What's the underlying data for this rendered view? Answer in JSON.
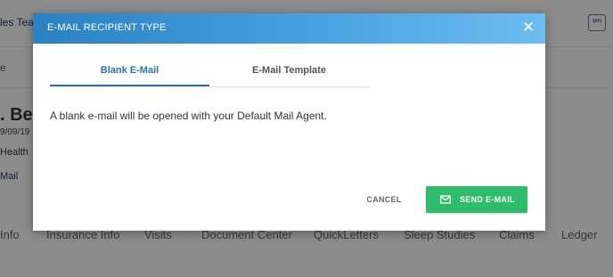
{
  "background": {
    "team_text": "les Tear",
    "row_text": "e",
    "patient_name": ". Bec",
    "dob": "9/09/19",
    "health": "Health",
    "mail": "Mail",
    "tabs": [
      "Info",
      "Insurance Info",
      "Visits",
      "Document Center",
      "QuickLetters",
      "Sleep Studies",
      "Claims",
      "Ledger"
    ],
    "sms_icon_text": "SMS"
  },
  "dialog": {
    "title": "E-MAIL RECIPIENT TYPE",
    "close_symbol": "✕",
    "tabs": [
      {
        "label": "Blank E-Mail",
        "active": true
      },
      {
        "label": "E-Mail Template",
        "active": false
      }
    ],
    "message": "A blank e-mail will be opened with your Default Mail Agent.",
    "cancel_label": "CANCEL",
    "send_label": "SEND E-MAIL",
    "send_icon": "envelope-icon"
  },
  "colors": {
    "header_gradient_start": "#2a80c0",
    "header_gradient_end": "#6dbcf2",
    "active_tab": "#2d6fb0",
    "send_button": "#2ebc6a"
  }
}
